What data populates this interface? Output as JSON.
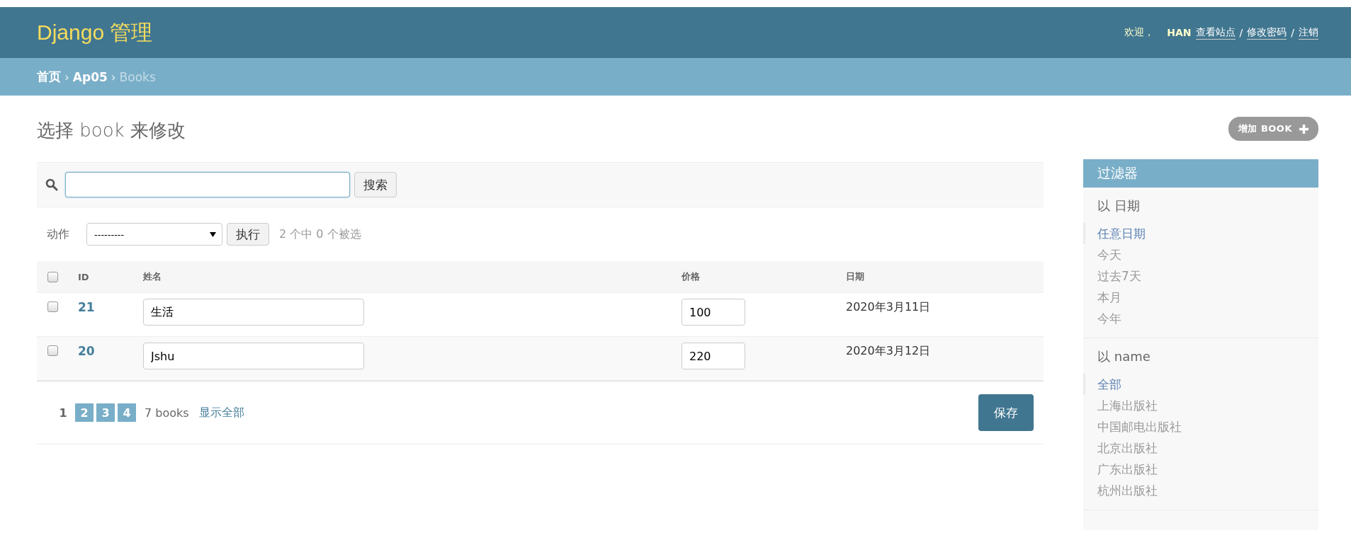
{
  "header": {
    "brand": "Django 管理",
    "welcome": "欢迎，",
    "user": "HAN",
    "links": [
      {
        "label": "查看站点",
        "kind": "link"
      },
      {
        "label": "/",
        "kind": "separator"
      },
      {
        "label": "修改密码",
        "kind": "link"
      },
      {
        "label": "/",
        "kind": "separator"
      },
      {
        "label": "注销",
        "kind": "link"
      }
    ]
  },
  "breadcrumbs": [
    {
      "label": "首页",
      "kind": "link"
    },
    {
      "label": "›",
      "kind": "separator"
    },
    {
      "label": "Ap05",
      "kind": "link"
    },
    {
      "label": "›",
      "kind": "separator"
    },
    {
      "label": "Books",
      "kind": "current"
    }
  ],
  "page_title": "选择 book 来修改",
  "add_button": "增加 BOOK",
  "search": {
    "button": "搜索"
  },
  "actions": {
    "label": "动作",
    "select_value": "---------",
    "button": "执行",
    "selection_count": "2 个中 0 个被选"
  },
  "table": {
    "select_all_checked": false,
    "columns": [
      "ID",
      "姓名",
      "价格",
      "日期"
    ],
    "rows": [
      {
        "checked": false,
        "id": "21",
        "name": "生活",
        "price": "100",
        "date": "2020年3月11日"
      },
      {
        "checked": false,
        "id": "20",
        "name": "Jshu",
        "price": "220",
        "date": "2020年3月12日"
      }
    ]
  },
  "pagination": {
    "pages": [
      {
        "label": "1",
        "selected": true
      },
      {
        "label": "2",
        "selected": false
      },
      {
        "label": "3",
        "selected": false
      },
      {
        "label": "4",
        "selected": false
      }
    ],
    "count": "7 books",
    "show_all": "显示全部"
  },
  "save_button": "保存",
  "filter": {
    "title": "过滤器",
    "groups": [
      {
        "title": "以 日期",
        "items": [
          {
            "label": "任意日期",
            "selected": true
          },
          {
            "label": "今天",
            "selected": false
          },
          {
            "label": "过去7天",
            "selected": false
          },
          {
            "label": "本月",
            "selected": false
          },
          {
            "label": "今年",
            "selected": false
          }
        ]
      },
      {
        "title": "以 name",
        "items": [
          {
            "label": "全部",
            "selected": true
          },
          {
            "label": "上海出版社",
            "selected": false
          },
          {
            "label": "中国邮电出版社",
            "selected": false
          },
          {
            "label": "北京出版社",
            "selected": false
          },
          {
            "label": "广东出版社",
            "selected": false
          },
          {
            "label": "杭州出版社",
            "selected": false
          }
        ]
      }
    ]
  }
}
